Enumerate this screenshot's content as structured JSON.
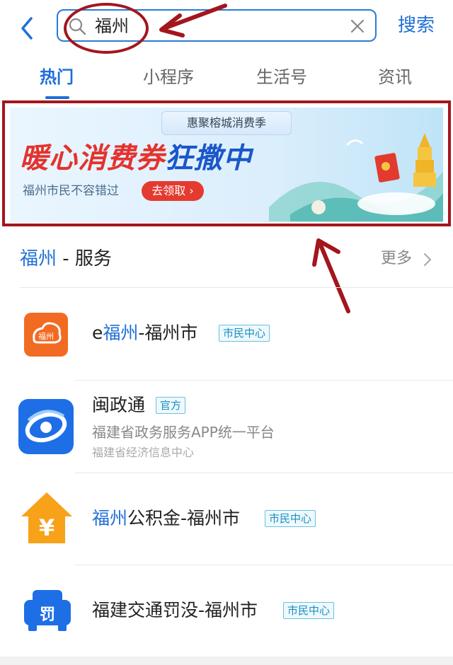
{
  "header": {
    "search_value": "福州",
    "search_button": "搜索"
  },
  "tabs": [
    {
      "label": "热门",
      "active": true
    },
    {
      "label": "小程序",
      "active": false
    },
    {
      "label": "生活号",
      "active": false
    },
    {
      "label": "资讯",
      "active": false
    }
  ],
  "banner": {
    "tag": "惠聚榕城消费季",
    "title_part1": "暖心消费券",
    "title_part2": "狂撒中",
    "subtitle": "福州市民不容错过",
    "cta": "去领取 ›"
  },
  "section": {
    "keyword": "福州",
    "title_rest": " - 服务",
    "more": "更多"
  },
  "results": [
    {
      "pre": "e",
      "kw": "福州",
      "post": "-福州市",
      "badge": "市民中心",
      "icon": "efuzhou-app-icon"
    },
    {
      "pre": "",
      "kw": "",
      "post": "闽政通",
      "badge": "官方",
      "desc": "福建省政务服务APP统一平台",
      "sub": "福建省经济信息中心",
      "icon": "minzhengtong-app-icon"
    },
    {
      "pre": "",
      "kw": "福州",
      "post": "公积金-福州市",
      "badge": "市民中心",
      "icon": "housing-fund-icon"
    },
    {
      "pre": "",
      "kw": "",
      "post": "福建交通罚没-福州市",
      "badge": "市民中心",
      "icon": "traffic-fine-icon"
    }
  ],
  "colors": {
    "accent": "#1f6fd6",
    "annotation_red": "#a3161c"
  }
}
